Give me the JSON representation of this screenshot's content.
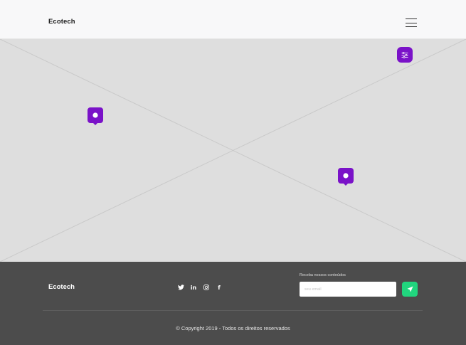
{
  "header": {
    "brand": "Ecotech",
    "menu_icon": "hamburger-menu-icon"
  },
  "map": {
    "filter_icon": "sliders-icon",
    "pins": [
      {
        "icon": "map-pin-icon",
        "color": "#7a12c8"
      },
      {
        "icon": "map-pin-icon",
        "color": "#7a12c8"
      }
    ],
    "background": "#dedede"
  },
  "footer": {
    "brand": "Ecotech",
    "social": [
      "twitter-icon",
      "linkedin-icon",
      "instagram-icon",
      "facebook-icon"
    ],
    "newsletter_label": "Receba nossos conteúdos",
    "email_placeholder": "seu email",
    "send_icon": "send-icon",
    "copyright": "© Copyright 2019 - Todos os direitos reservados"
  },
  "colors": {
    "accent": "#7a12c8",
    "send": "#21d57e",
    "footer_bg": "#4c4c4c"
  }
}
